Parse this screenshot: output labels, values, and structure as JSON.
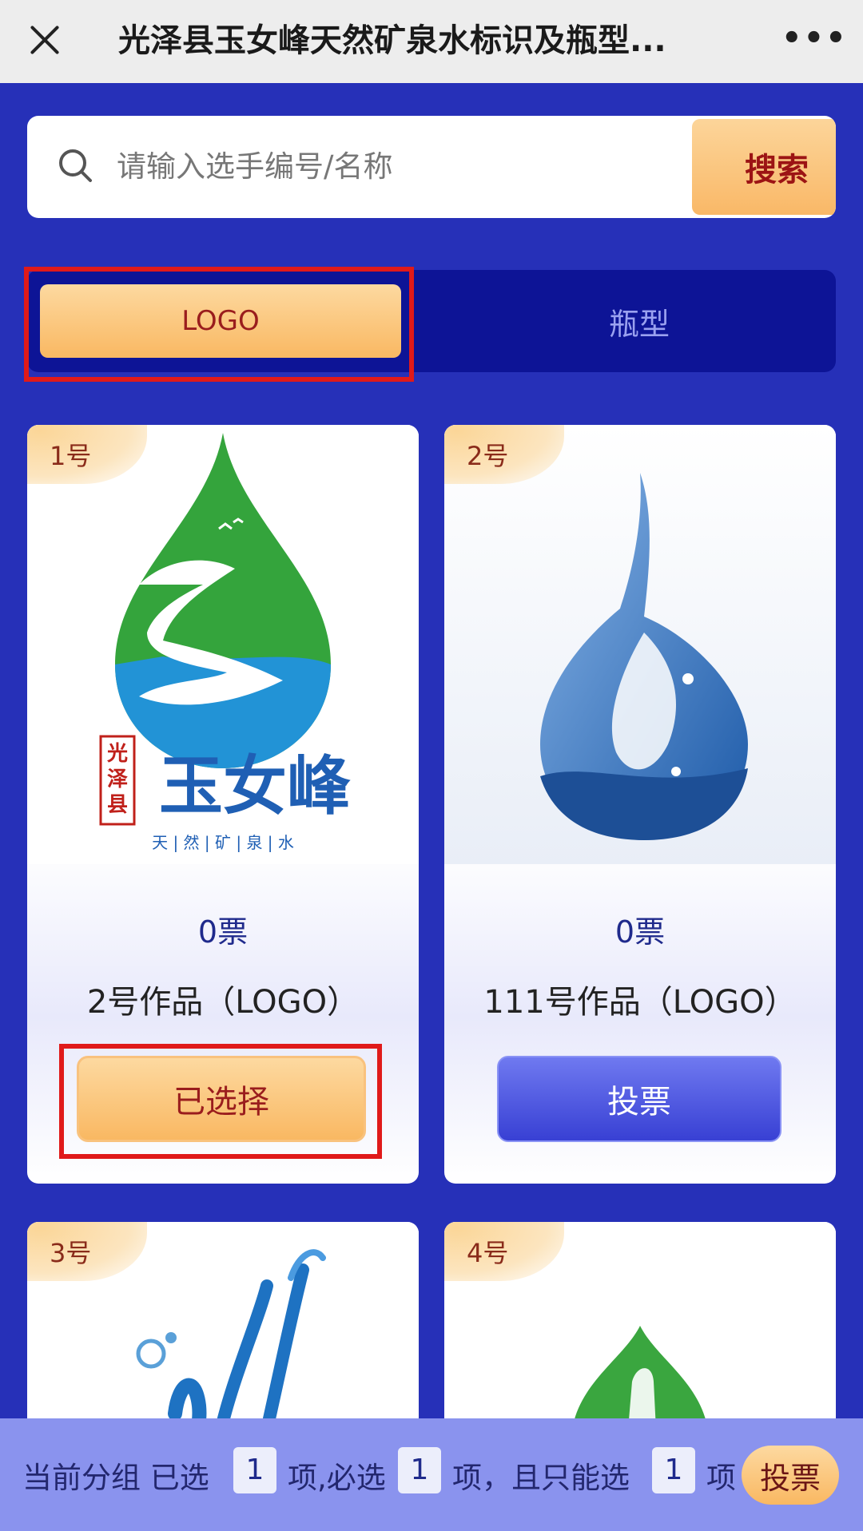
{
  "topbar": {
    "title": "光泽县玉女峰天然矿泉水标识及瓶型...",
    "more": "•••"
  },
  "search": {
    "placeholder": "请输入选手编号/名称",
    "button": "搜索"
  },
  "tabs": [
    {
      "label": "LOGO",
      "active": true
    },
    {
      "label": "瓶型",
      "active": false
    }
  ],
  "cards": [
    {
      "num": "1号",
      "votes": "0票",
      "name": "2号作品（LOGO）",
      "button": "已选择",
      "selected": true,
      "logo_text": "玉女峰",
      "logo_side": "光泽县",
      "logo_sub": "天 | 然 | 矿 | 泉 | 水"
    },
    {
      "num": "2号",
      "votes": "0票",
      "name": "111号作品（LOGO）",
      "button": "投票",
      "selected": false
    },
    {
      "num": "3号"
    },
    {
      "num": "4号"
    }
  ],
  "bottom": {
    "prefix": "当前分组 已选",
    "selected_count": "1",
    "mid1": "项,必选",
    "required_count": "1",
    "mid2": "项，且只能选",
    "max_count": "1",
    "suffix": "项",
    "vote_button": "投票"
  },
  "colors": {
    "background": "#2630b8",
    "accent_orange": "#f9b862",
    "selected_red": "#e01a1a",
    "vote_blue": "#3840d4"
  }
}
